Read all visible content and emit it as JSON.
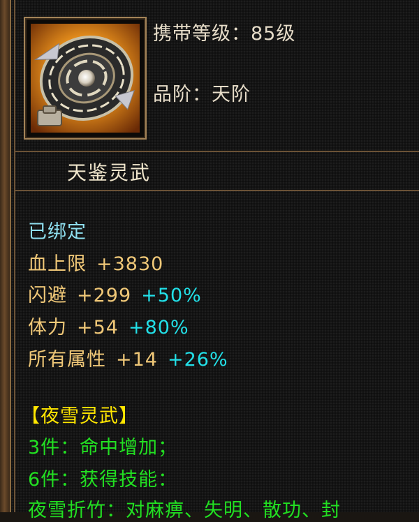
{
  "item": {
    "required_level": "携带等级：85级",
    "quality": "品阶：天阶",
    "name": "天鉴灵武",
    "bound": "已绑定"
  },
  "stats": [
    {
      "label": "血上限",
      "flat": "+3830",
      "percent": ""
    },
    {
      "label": "闪避",
      "flat": "+299",
      "percent": "+50%"
    },
    {
      "label": "体力",
      "flat": "+54",
      "percent": "+80%"
    },
    {
      "label": "所有属性",
      "flat": "+14",
      "percent": "+26%"
    }
  ],
  "set": {
    "title": "【夜雪灵武】",
    "bonus_3": "3件：命中增加；",
    "bonus_6": "6件：获得技能：",
    "skill_desc": "夜雪折竹：对麻痹、失明、散功、封"
  },
  "colors": {
    "bound": "#8fe0f0",
    "stat_label": "#f0c878",
    "percent": "#22e0e8",
    "set_title": "#ffe600",
    "set_bonus": "#22e022"
  }
}
